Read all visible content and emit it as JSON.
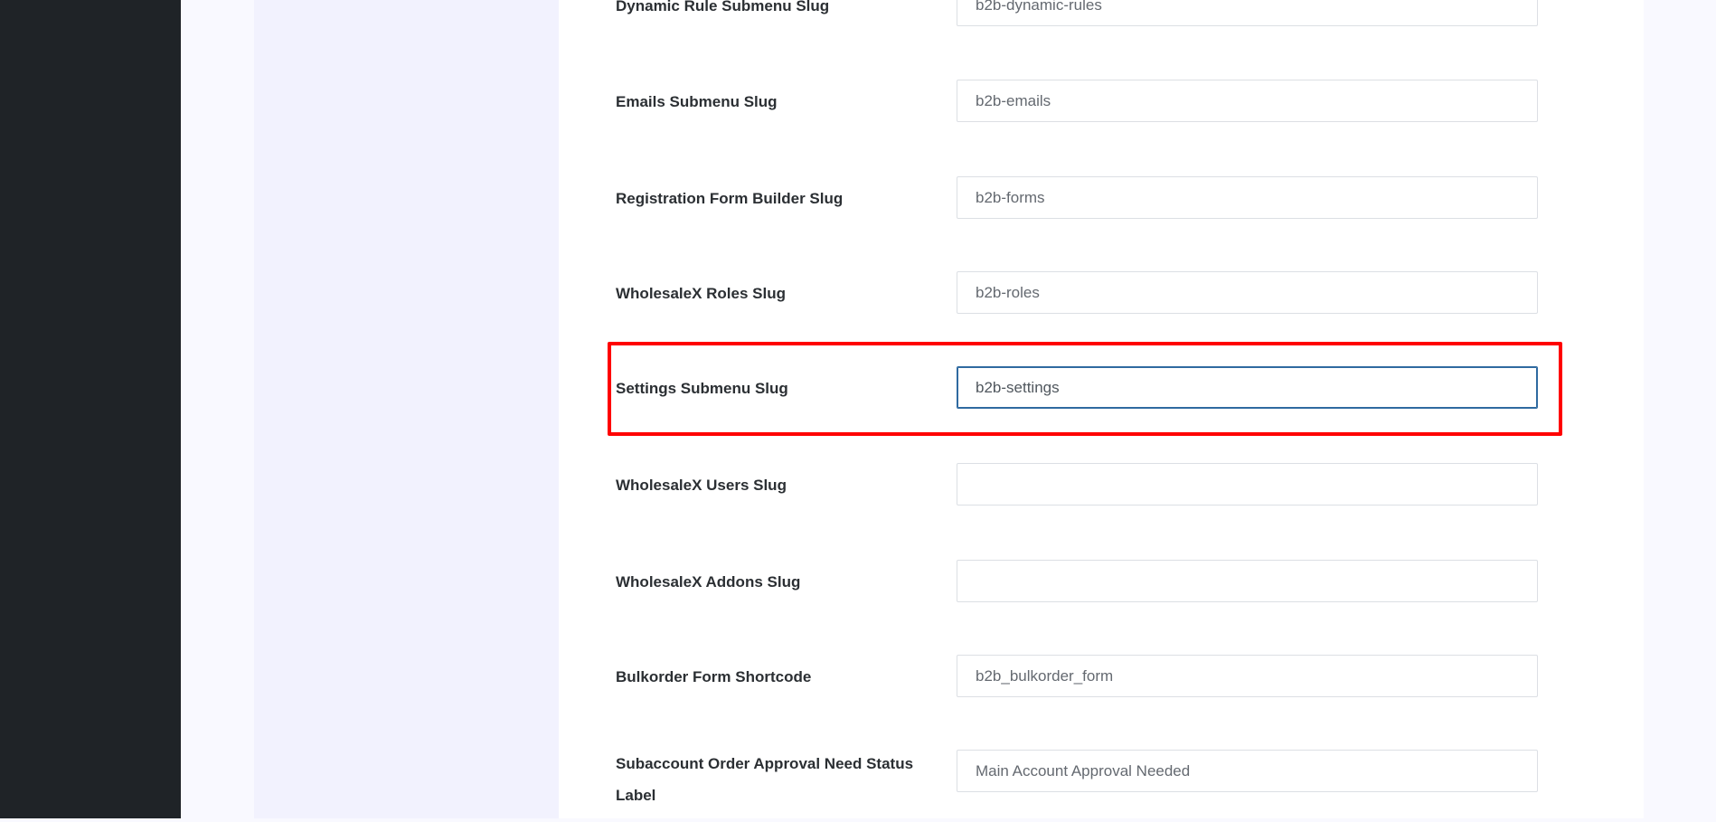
{
  "highlight_color": "#ff0000",
  "fields": [
    {
      "label": "Dynamic Rule Submenu Slug",
      "value": "b2b-dynamic-rules"
    },
    {
      "label": "Emails Submenu Slug",
      "value": "b2b-emails"
    },
    {
      "label": "Registration Form Builder Slug",
      "value": "b2b-forms"
    },
    {
      "label": "WholesaleX Roles Slug",
      "value": "b2b-roles"
    },
    {
      "label": "Settings Submenu Slug",
      "value": "b2b-settings"
    },
    {
      "label": "WholesaleX Users Slug",
      "value": ""
    },
    {
      "label": "WholesaleX Addons Slug",
      "value": ""
    },
    {
      "label": "Bulkorder Form Shortcode",
      "value": "b2b_bulkorder_form"
    },
    {
      "label": "Subaccount Order Approval Need Status Label",
      "value": "Main Account Approval Needed"
    }
  ]
}
